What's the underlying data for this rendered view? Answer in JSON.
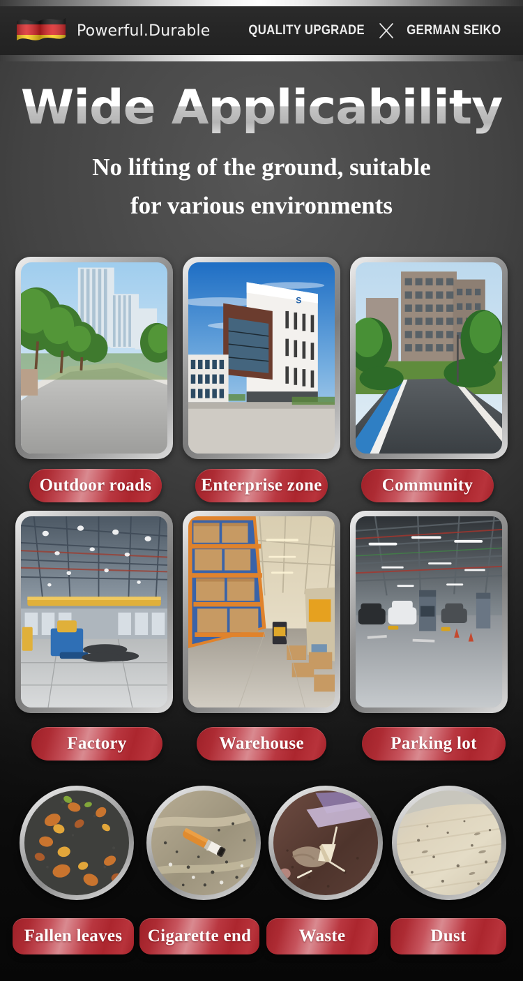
{
  "header": {
    "flag_icon": "german-flag-icon",
    "brand_text": "Powerful.Durable",
    "tagline_left": "QUALITY UPGRADE",
    "tagline_separator_icon": "cross-x-icon",
    "tagline_right": "GERMAN SEIKO"
  },
  "title": {
    "main": "Wide Applicability",
    "sub_line1": "No lifting of the ground, suitable",
    "sub_line2": "for various environments"
  },
  "colors": {
    "pill_red_dark": "#9e2028",
    "pill_red_light": "#d98a90",
    "frame_silver": "#c7c7c7",
    "background_dark": "#1d1d1d",
    "title_white": "#ffffff",
    "title_grey": "#b4b4b4"
  },
  "scenes_row1": [
    {
      "label": "Outdoor roads",
      "image": "tree-lined-city-road-photo"
    },
    {
      "label": "Enterprise zone",
      "image": "modern-office-building-photo"
    },
    {
      "label": "Community",
      "image": "residential-complex-road-photo"
    }
  ],
  "scenes_row2": [
    {
      "label": "Factory",
      "image": "industrial-factory-interior-photo"
    },
    {
      "label": "Warehouse",
      "image": "warehouse-racking-aisle-photo"
    },
    {
      "label": "Parking lot",
      "image": "underground-parking-garage-photo"
    }
  ],
  "debris_row": [
    {
      "label": "Fallen leaves",
      "image": "fallen-leaves-on-asphalt-photo"
    },
    {
      "label": "Cigarette end",
      "image": "cigarette-butt-on-ground-photo"
    },
    {
      "label": "Waste",
      "image": "litter-waste-on-ground-photo"
    },
    {
      "label": "Dust",
      "image": "dusty-floor-surface-photo"
    }
  ]
}
